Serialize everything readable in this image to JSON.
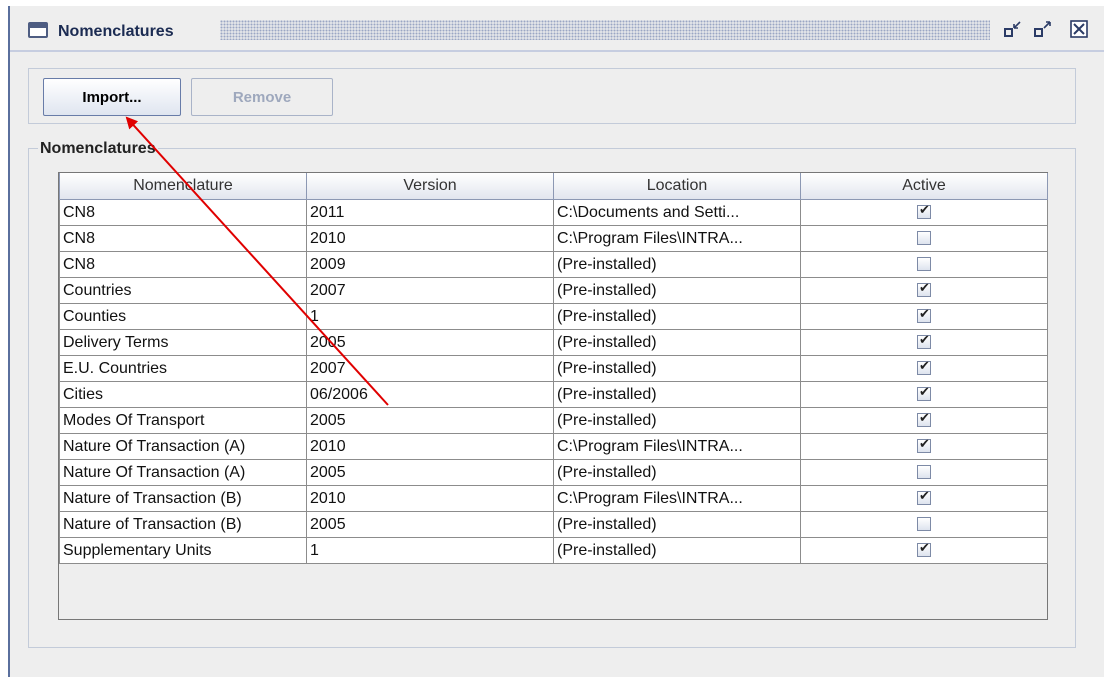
{
  "window": {
    "title": "Nomenclatures",
    "icons": {
      "app": "window-icon",
      "minimize": "minimize-icon",
      "maximize": "maximize-icon",
      "close": "close-icon"
    }
  },
  "toolbar": {
    "import_label": "Import...",
    "remove_label": "Remove"
  },
  "group": {
    "label": "Nomenclatures"
  },
  "table": {
    "columns": [
      "Nomenclature",
      "Version",
      "Location",
      "Active"
    ],
    "rows": [
      {
        "nomenclature": "CN8",
        "version": "2011",
        "location": "C:\\Documents and Setti...",
        "active": true
      },
      {
        "nomenclature": "CN8",
        "version": "2010",
        "location": "C:\\Program Files\\INTRA...",
        "active": false
      },
      {
        "nomenclature": "CN8",
        "version": "2009",
        "location": "(Pre-installed)",
        "active": false
      },
      {
        "nomenclature": "Countries",
        "version": "2007",
        "location": "(Pre-installed)",
        "active": true
      },
      {
        "nomenclature": "Counties",
        "version": "1",
        "location": "(Pre-installed)",
        "active": true
      },
      {
        "nomenclature": "Delivery Terms",
        "version": "2005",
        "location": "(Pre-installed)",
        "active": true
      },
      {
        "nomenclature": "E.U. Countries",
        "version": "2007",
        "location": "(Pre-installed)",
        "active": true
      },
      {
        "nomenclature": "Cities",
        "version": "06/2006",
        "location": "(Pre-installed)",
        "active": true
      },
      {
        "nomenclature": "Modes Of Transport",
        "version": "2005",
        "location": "(Pre-installed)",
        "active": true
      },
      {
        "nomenclature": "Nature Of Transaction (A)",
        "version": "2010",
        "location": "C:\\Program Files\\INTRA...",
        "active": true
      },
      {
        "nomenclature": "Nature Of Transaction (A)",
        "version": "2005",
        "location": "(Pre-installed)",
        "active": false
      },
      {
        "nomenclature": "Nature of Transaction (B)",
        "version": "2010",
        "location": "C:\\Program Files\\INTRA...",
        "active": true
      },
      {
        "nomenclature": "Nature of Transaction (B)",
        "version": "2005",
        "location": "(Pre-installed)",
        "active": false
      },
      {
        "nomenclature": "Supplementary Units",
        "version": "1",
        "location": "(Pre-installed)",
        "active": true
      }
    ]
  },
  "annotation": {
    "color": "#e00000"
  }
}
